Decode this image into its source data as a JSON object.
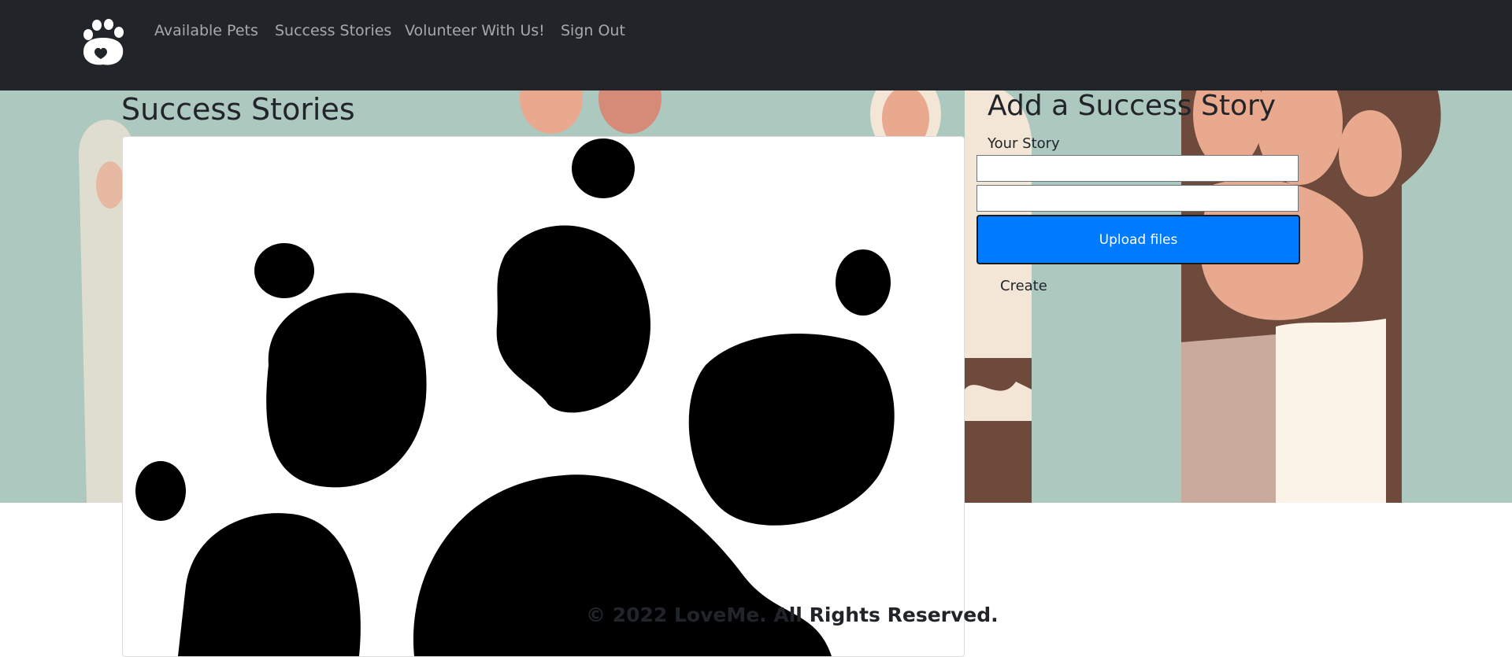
{
  "nav": {
    "logo_icon": "paw-heart-icon",
    "links": [
      "Available Pets",
      "Success Stories",
      "Volunteer With Us!",
      "Sign Out"
    ]
  },
  "page": {
    "title": "Success Stories"
  },
  "story_card": {
    "image_icon": "paw-print-icon"
  },
  "form": {
    "title": "Add a Success Story",
    "story_label": "Your Story",
    "story_value": "",
    "file_value": "",
    "upload_label": "Upload files",
    "create_label": "Create"
  },
  "footer": {
    "text": "© 2022 LoveMe. All Rights Reserved."
  },
  "colors": {
    "navbar": "#212529",
    "hero_bg": "#adc8bf",
    "upload_button": "#007bff"
  }
}
